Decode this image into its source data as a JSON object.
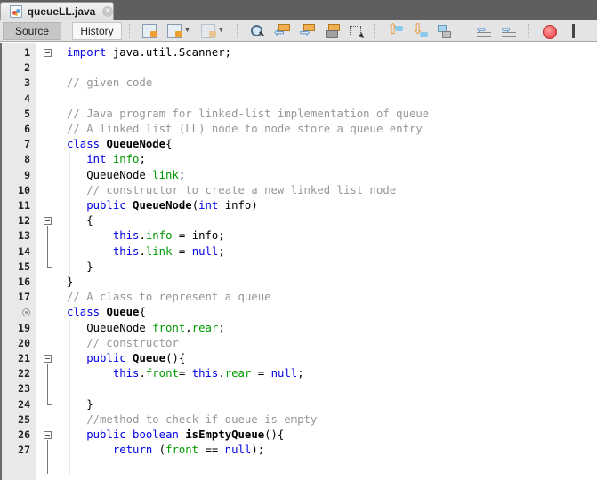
{
  "tab": {
    "title": "queueLL.java",
    "icon": "java-file-icon",
    "close_label": "×"
  },
  "toolbar": {
    "source_label": "Source",
    "history_label": "History",
    "icons": [
      "last-edit-icon",
      "back-icon",
      "forward-icon",
      "find-selection-icon",
      "find-previous-icon",
      "find-next-icon",
      "toggle-highlight-icon",
      "toggle-rectangular-selection-icon",
      "previous-bookmark-icon",
      "next-bookmark-icon",
      "toggle-bookmark-icon",
      "shift-left-icon",
      "shift-right-icon",
      "start-macro-recording-icon"
    ]
  },
  "colors": {
    "keyword": "#0000e6",
    "comment": "#969696",
    "field": "#009900",
    "gutter": "#e9e9e9",
    "tabstrip": "#5f5f5f",
    "toolbar": "#e4e4e4"
  },
  "editor": {
    "lines": [
      {
        "num": "1",
        "tokens": [
          {
            "t": "import",
            "c": "kw"
          },
          {
            "t": " java.util.Scanner;"
          }
        ]
      },
      {
        "num": "2",
        "tokens": []
      },
      {
        "num": "3",
        "tokens": [
          {
            "t": "// given code",
            "c": "cm"
          }
        ]
      },
      {
        "num": "4",
        "tokens": []
      },
      {
        "num": "5",
        "tokens": [
          {
            "t": "// Java program for linked-list implementation of queue",
            "c": "cm"
          }
        ]
      },
      {
        "num": "6",
        "tokens": [
          {
            "t": "// A linked list (LL) node to node store a queue entry",
            "c": "cm"
          }
        ]
      },
      {
        "num": "7",
        "tokens": [
          {
            "t": "class",
            "c": "kw"
          },
          {
            "t": " "
          },
          {
            "t": "QueueNode",
            "c": "bd"
          },
          {
            "t": "{"
          }
        ]
      },
      {
        "num": "8",
        "tokens": [
          {
            "t": "   "
          },
          {
            "t": "int",
            "c": "kw"
          },
          {
            "t": " "
          },
          {
            "t": "info",
            "c": "fd"
          },
          {
            "t": ";"
          }
        ]
      },
      {
        "num": "9",
        "tokens": [
          {
            "t": "   QueueNode "
          },
          {
            "t": "link",
            "c": "fd"
          },
          {
            "t": ";"
          }
        ]
      },
      {
        "num": "10",
        "tokens": [
          {
            "t": "   // constructor to create a new linked list node",
            "c": "cm"
          }
        ]
      },
      {
        "num": "11",
        "tokens": [
          {
            "t": "   "
          },
          {
            "t": "public",
            "c": "kw"
          },
          {
            "t": " "
          },
          {
            "t": "QueueNode",
            "c": "bd"
          },
          {
            "t": "("
          },
          {
            "t": "int",
            "c": "kw"
          },
          {
            "t": " info)"
          }
        ]
      },
      {
        "num": "12",
        "tokens": [
          {
            "t": "   {"
          }
        ]
      },
      {
        "num": "13",
        "tokens": [
          {
            "t": "       "
          },
          {
            "t": "this",
            "c": "kw"
          },
          {
            "t": "."
          },
          {
            "t": "info",
            "c": "fd"
          },
          {
            "t": " = info;"
          }
        ]
      },
      {
        "num": "14",
        "tokens": [
          {
            "t": "       "
          },
          {
            "t": "this",
            "c": "kw"
          },
          {
            "t": "."
          },
          {
            "t": "link",
            "c": "fd"
          },
          {
            "t": " = "
          },
          {
            "t": "null",
            "c": "kw"
          },
          {
            "t": ";"
          }
        ]
      },
      {
        "num": "15",
        "tokens": [
          {
            "t": "   }"
          }
        ]
      },
      {
        "num": "16",
        "tokens": [
          {
            "t": "}"
          }
        ]
      },
      {
        "num": "17",
        "tokens": [
          {
            "t": "// A class to represent a queue",
            "c": "cm"
          }
        ]
      },
      {
        "num": "",
        "marker": "overridden-method-icon",
        "tokens": [
          {
            "t": "class",
            "c": "kw"
          },
          {
            "t": " "
          },
          {
            "t": "Queue",
            "c": "bd"
          },
          {
            "t": "{"
          }
        ]
      },
      {
        "num": "19",
        "tokens": [
          {
            "t": "   QueueNode "
          },
          {
            "t": "front",
            "c": "fd"
          },
          {
            "t": ","
          },
          {
            "t": "rear",
            "c": "fd"
          },
          {
            "t": ";"
          }
        ]
      },
      {
        "num": "20",
        "tokens": [
          {
            "t": "   // constructor",
            "c": "cm"
          }
        ]
      },
      {
        "num": "21",
        "tokens": [
          {
            "t": "   "
          },
          {
            "t": "public",
            "c": "kw"
          },
          {
            "t": " "
          },
          {
            "t": "Queue",
            "c": "bd"
          },
          {
            "t": "(){"
          }
        ]
      },
      {
        "num": "22",
        "tokens": [
          {
            "t": "       "
          },
          {
            "t": "this",
            "c": "kw"
          },
          {
            "t": "."
          },
          {
            "t": "front",
            "c": "fd"
          },
          {
            "t": "= "
          },
          {
            "t": "this",
            "c": "kw"
          },
          {
            "t": "."
          },
          {
            "t": "rear",
            "c": "fd"
          },
          {
            "t": " = "
          },
          {
            "t": "null",
            "c": "kw"
          },
          {
            "t": ";"
          }
        ]
      },
      {
        "num": "23",
        "tokens": []
      },
      {
        "num": "24",
        "tokens": [
          {
            "t": "   }"
          }
        ]
      },
      {
        "num": "25",
        "tokens": [
          {
            "t": "   //method to check if queue is empty",
            "c": "cm"
          }
        ]
      },
      {
        "num": "26",
        "tokens": [
          {
            "t": "   "
          },
          {
            "t": "public",
            "c": "kw"
          },
          {
            "t": " "
          },
          {
            "t": "boolean",
            "c": "kw"
          },
          {
            "t": " "
          },
          {
            "t": "isEmptyQueue",
            "c": "bd"
          },
          {
            "t": "(){"
          }
        ]
      },
      {
        "num": "27",
        "tokens": [
          {
            "t": "       "
          },
          {
            "t": "return",
            "c": "kw"
          },
          {
            "t": " ("
          },
          {
            "t": "front",
            "c": "fd"
          },
          {
            "t": " == "
          },
          {
            "t": "null",
            "c": "kw"
          },
          {
            "t": ");"
          }
        ]
      }
    ]
  }
}
